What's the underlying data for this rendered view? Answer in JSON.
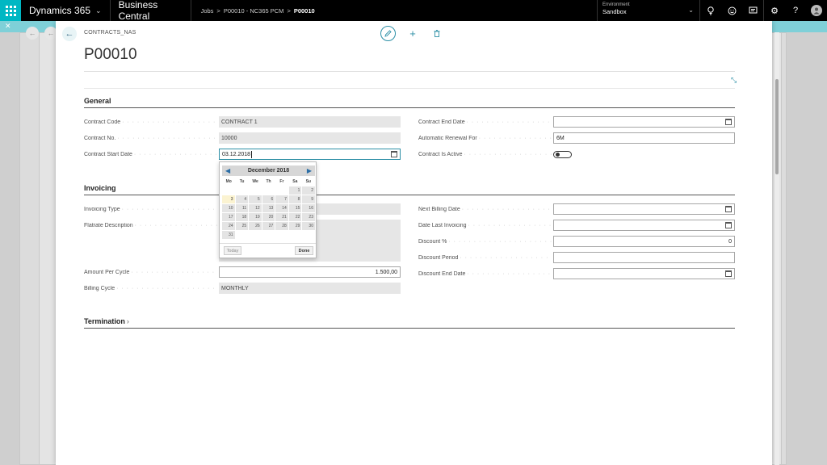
{
  "topbar": {
    "brand": "Dynamics 365",
    "product": "Business Central",
    "breadcrumb": [
      "Jobs",
      "P00010 - NC365 PCM",
      "P00010"
    ],
    "environment_label": "Environment",
    "environment_value": "Sandbox",
    "icons": [
      "waffle-icon",
      "lightbulb-icon",
      "smiley-icon",
      "chat-icon",
      "gear-icon",
      "help-icon",
      "avatar"
    ]
  },
  "page": {
    "caption": "CONTRACTS_NAS",
    "title": "P00010",
    "actions": [
      "edit-icon",
      "add-icon",
      "delete-icon"
    ]
  },
  "sections": {
    "general": {
      "title": "General",
      "fields": {
        "contract_code": {
          "label": "Contract Code",
          "value": "CONTRACT 1"
        },
        "contract_no": {
          "label": "Contract No.",
          "value": "10000"
        },
        "contract_start_date": {
          "label": "Contract Start Date",
          "value": "03.12.2018"
        },
        "contract_end_date": {
          "label": "Contract End Date",
          "value": ""
        },
        "automatic_renewal_for": {
          "label": "Automatic Renewal For",
          "value": "6M"
        },
        "contract_is_active": {
          "label": "Contract Is Active",
          "value": false
        }
      }
    },
    "invoicing": {
      "title": "Invoicing",
      "fields": {
        "invoicing_type": {
          "label": "Invoicing Type",
          "value": ""
        },
        "flatrate_description": {
          "label": "Flatrate Description",
          "value": ""
        },
        "amount_per_cycle": {
          "label": "Amount Per Cycle",
          "value": "1.500,00"
        },
        "billing_cycle": {
          "label": "Billing Cycle",
          "value": "MONTHLY"
        },
        "next_billing_date": {
          "label": "Next Billing Date",
          "value": ""
        },
        "date_last_invoicing": {
          "label": "Date Last Invoicing",
          "value": ""
        },
        "discount_pct": {
          "label": "Discount %",
          "value": "0"
        },
        "discount_period": {
          "label": "Discount Period",
          "value": ""
        },
        "discount_end_date": {
          "label": "Discount End Date",
          "value": ""
        }
      }
    },
    "termination": {
      "title": "Termination"
    }
  },
  "datepicker": {
    "month_title": "December 2018",
    "weekdays": [
      "Mo",
      "Tu",
      "We",
      "Th",
      "Fr",
      "Sa",
      "Su"
    ],
    "leading_blanks": 5,
    "days": [
      "1",
      "2",
      "3",
      "4",
      "5",
      "6",
      "7",
      "8",
      "9",
      "10",
      "11",
      "12",
      "13",
      "14",
      "15",
      "16",
      "17",
      "18",
      "19",
      "20",
      "21",
      "22",
      "23",
      "24",
      "25",
      "26",
      "27",
      "28",
      "29",
      "30",
      "31"
    ],
    "highlighted_day": "3",
    "today_label": "Today",
    "done_label": "Done"
  }
}
